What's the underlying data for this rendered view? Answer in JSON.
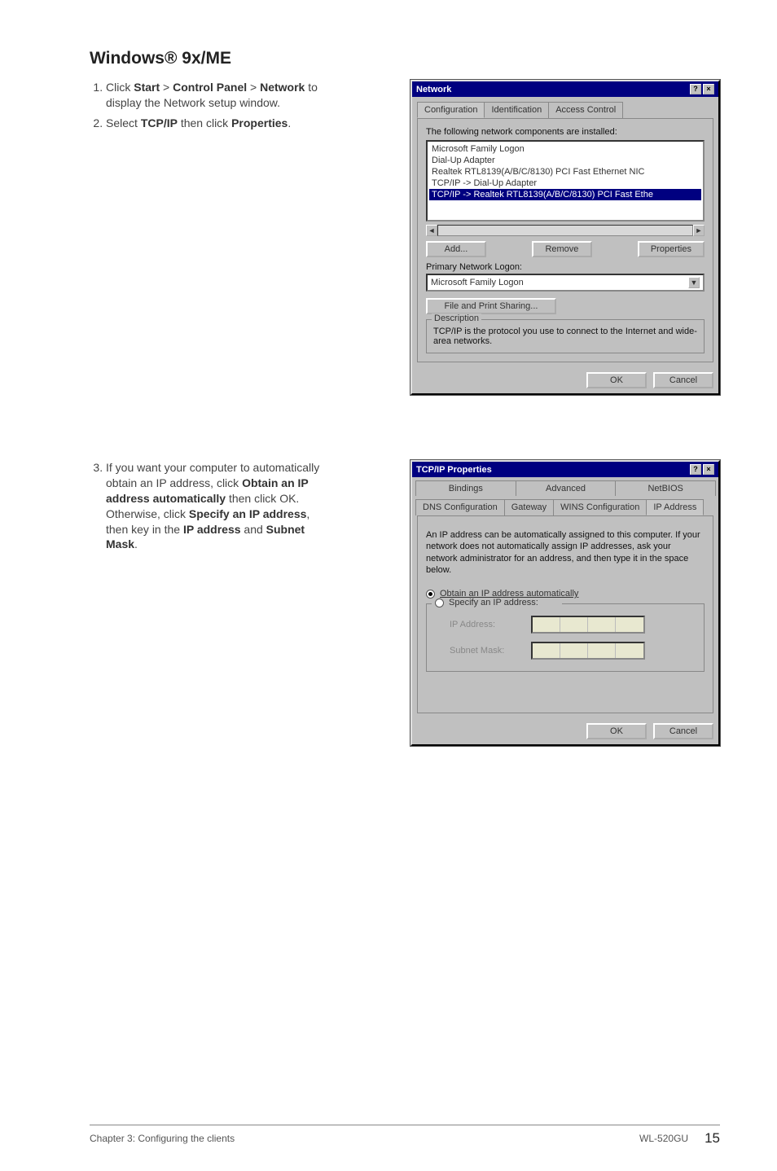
{
  "heading": "Windows® 9x/ME",
  "steps_a": {
    "s1_pre": "Click ",
    "s1_b1": "Start",
    "s1_gt1": " > ",
    "s1_b2": "Control Panel",
    "s1_gt2": " > ",
    "s1_b3": "Network",
    "s1_post": " to display the Network setup window.",
    "s2_pre": "Select ",
    "s2_b1": "TCP/IP",
    "s2_mid": " then click ",
    "s2_b2": "Properties",
    "s2_post": "."
  },
  "steps_b": {
    "s3_pre": "If you want your computer to automatically obtain an IP address, click ",
    "s3_b1": "Obtain an IP address automatically",
    "s3_mid1": " then click OK. Otherwise, click ",
    "s3_b2": "Specify an IP address",
    "s3_mid2": ", then key in the ",
    "s3_b3": "IP address",
    "s3_mid3": " and ",
    "s3_b4": "Subnet Mask",
    "s3_post": "."
  },
  "dlg1": {
    "title": "Network",
    "tabs": {
      "t1": "Configuration",
      "t2": "Identification",
      "t3": "Access Control"
    },
    "installed_label": "The following network components are installed:",
    "items": {
      "i1": "Microsoft Family Logon",
      "i2": "Dial-Up Adapter",
      "i3": "Realtek RTL8139(A/B/C/8130) PCI Fast Ethernet NIC",
      "i4": "TCP/IP -> Dial-Up Adapter",
      "i5": "TCP/IP -> Realtek RTL8139(A/B/C/8130) PCI Fast Ethe"
    },
    "btn_add": "Add...",
    "btn_remove": "Remove",
    "btn_props": "Properties",
    "primary_label": "Primary Network Logon:",
    "primary_value": "Microsoft Family Logon",
    "fps": "File and Print Sharing...",
    "desc_title": "Description",
    "desc_text": "TCP/IP is the protocol you use to connect to the Internet and wide-area networks.",
    "ok": "OK",
    "cancel": "Cancel"
  },
  "dlg2": {
    "title": "TCP/IP Properties",
    "tabs": {
      "t1": "Bindings",
      "t2": "Advanced",
      "t3": "NetBIOS",
      "t4": "DNS Configuration",
      "t5": "Gateway",
      "t6": "WINS Configuration",
      "t7": "IP Address"
    },
    "info": "An IP address can be automatically assigned to this computer. If your network does not automatically assign IP addresses, ask your network administrator for an address, and then type it in the space below.",
    "r1": "Obtain an IP address automatically",
    "r2": "Specify an IP address:",
    "ip_label": "IP Address:",
    "mask_label": "Subnet Mask:",
    "ok": "OK",
    "cancel": "Cancel"
  },
  "footer": {
    "left": "Chapter 3: Configuring the clients",
    "model": "WL-520GU",
    "page": "15"
  }
}
